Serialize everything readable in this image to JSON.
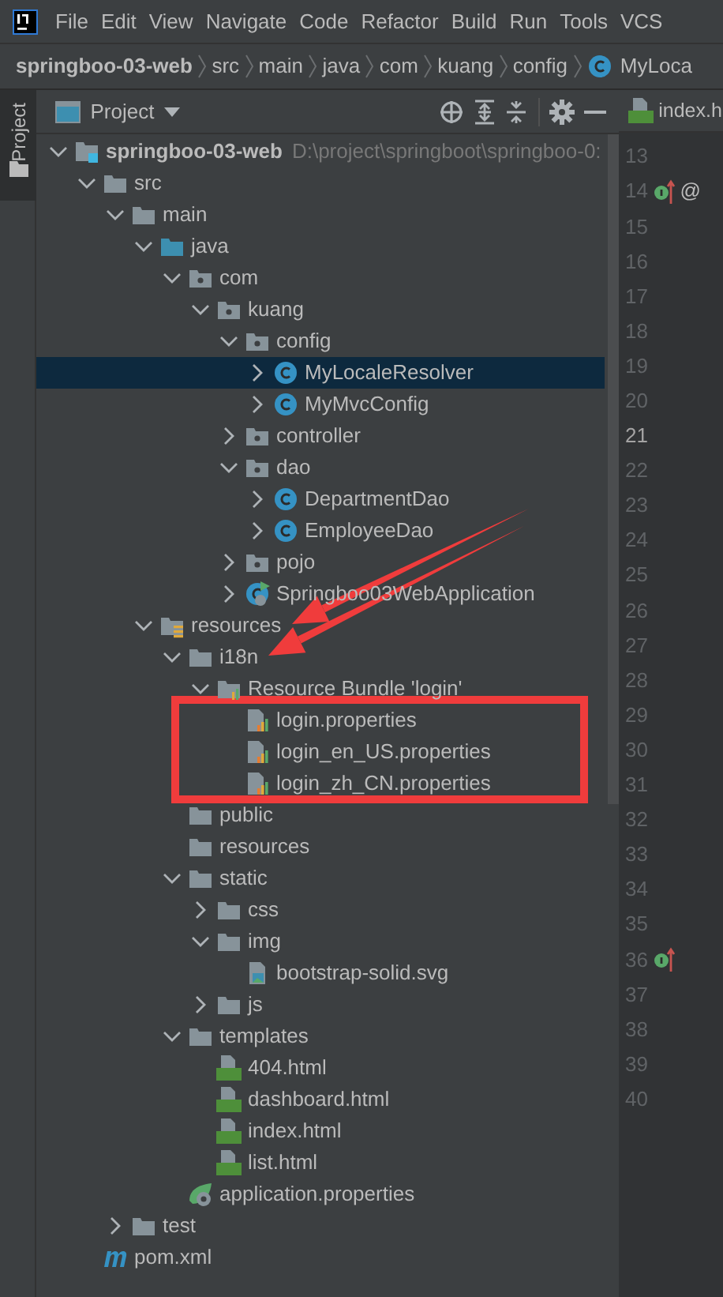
{
  "menu_bar": {
    "items": [
      "File",
      "Edit",
      "View",
      "Navigate",
      "Code",
      "Refactor",
      "Build",
      "Run",
      "Tools",
      "VCS"
    ]
  },
  "breadcrumbs": [
    {
      "label": "springboo-03-web",
      "kind": "module"
    },
    {
      "label": "src",
      "kind": "folder"
    },
    {
      "label": "main",
      "kind": "folder"
    },
    {
      "label": "java",
      "kind": "folder"
    },
    {
      "label": "com",
      "kind": "folder"
    },
    {
      "label": "kuang",
      "kind": "folder"
    },
    {
      "label": "config",
      "kind": "folder"
    },
    {
      "label": "MyLoca",
      "kind": "class"
    }
  ],
  "side_tab": {
    "label": "Project",
    "selected": true
  },
  "project_panel": {
    "title": "Project",
    "tree": [
      {
        "label": "springboo-03-web",
        "path": "D:\\project\\springboot\\springboo-0:",
        "kind": "module",
        "expanded": true,
        "selected": false,
        "children": [
          {
            "label": "src",
            "kind": "folder",
            "expanded": true,
            "selected": false,
            "children": [
              {
                "label": "main",
                "kind": "folder",
                "expanded": true,
                "selected": false,
                "children": [
                  {
                    "label": "java",
                    "kind": "source",
                    "expanded": true,
                    "selected": false,
                    "children": [
                      {
                        "label": "com",
                        "kind": "package",
                        "expanded": true,
                        "selected": false,
                        "children": [
                          {
                            "label": "kuang",
                            "kind": "package",
                            "expanded": true,
                            "selected": false,
                            "children": [
                              {
                                "label": "config",
                                "kind": "package",
                                "expanded": true,
                                "selected": false,
                                "children": [
                                  {
                                    "label": "MyLocaleResolver",
                                    "kind": "class",
                                    "expanded": false,
                                    "selected": true
                                  },
                                  {
                                    "label": "MyMvcConfig",
                                    "kind": "class",
                                    "expanded": false,
                                    "selected": false
                                  }
                                ]
                              },
                              {
                                "label": "controller",
                                "kind": "package",
                                "expanded": false,
                                "selected": false
                              },
                              {
                                "label": "dao",
                                "kind": "package",
                                "expanded": true,
                                "selected": false,
                                "children": [
                                  {
                                    "label": "DepartmentDao",
                                    "kind": "class",
                                    "expanded": false,
                                    "selected": false
                                  },
                                  {
                                    "label": "EmployeeDao",
                                    "kind": "class",
                                    "expanded": false,
                                    "selected": false
                                  }
                                ]
                              },
                              {
                                "label": "pojo",
                                "kind": "package",
                                "expanded": false,
                                "selected": false
                              },
                              {
                                "label": "Springboo03WebApplication",
                                "kind": "spring-class",
                                "expanded": false,
                                "selected": false
                              }
                            ]
                          }
                        ]
                      }
                    ]
                  },
                  {
                    "label": "resources",
                    "kind": "resources",
                    "expanded": true,
                    "selected": false,
                    "children": [
                      {
                        "label": "i18n",
                        "kind": "folder",
                        "expanded": true,
                        "selected": false,
                        "children": [
                          {
                            "label": "Resource Bundle 'login'",
                            "kind": "bundle",
                            "expanded": true,
                            "selected": false,
                            "children": [
                              {
                                "label": "login.properties",
                                "kind": "properties",
                                "selected": false
                              },
                              {
                                "label": "login_en_US.properties",
                                "kind": "properties",
                                "selected": false
                              },
                              {
                                "label": "login_zh_CN.properties",
                                "kind": "properties",
                                "selected": false
                              }
                            ]
                          }
                        ]
                      },
                      {
                        "label": "public",
                        "kind": "folder",
                        "selected": false
                      },
                      {
                        "label": "resources",
                        "kind": "folder",
                        "selected": false
                      },
                      {
                        "label": "static",
                        "kind": "folder",
                        "expanded": true,
                        "selected": false,
                        "children": [
                          {
                            "label": "css",
                            "kind": "folder",
                            "expanded": false,
                            "selected": false
                          },
                          {
                            "label": "img",
                            "kind": "folder",
                            "expanded": true,
                            "selected": false,
                            "children": [
                              {
                                "label": "bootstrap-solid.svg",
                                "kind": "image",
                                "selected": false
                              }
                            ]
                          },
                          {
                            "label": "js",
                            "kind": "folder",
                            "expanded": false,
                            "selected": false
                          }
                        ]
                      },
                      {
                        "label": "templates",
                        "kind": "folder",
                        "expanded": true,
                        "selected": false,
                        "children": [
                          {
                            "label": "404.html",
                            "kind": "html",
                            "selected": false
                          },
                          {
                            "label": "dashboard.html",
                            "kind": "html",
                            "selected": false
                          },
                          {
                            "label": "index.html",
                            "kind": "html",
                            "selected": false
                          },
                          {
                            "label": "list.html",
                            "kind": "html",
                            "selected": false
                          }
                        ]
                      },
                      {
                        "label": "application.properties",
                        "kind": "spring-properties",
                        "selected": false
                      }
                    ]
                  }
                ]
              },
              {
                "label": "test",
                "kind": "folder",
                "expanded": false,
                "selected": false
              }
            ]
          },
          {
            "label": "pom.xml",
            "kind": "maven",
            "selected": false
          }
        ]
      }
    ]
  },
  "editor": {
    "tab": "index.h",
    "lines": [
      {
        "number": "13",
        "current": false
      },
      {
        "number": "14",
        "current": false,
        "marker": true,
        "extra": "@"
      },
      {
        "number": "15",
        "current": false
      },
      {
        "number": "16",
        "current": false
      },
      {
        "number": "17",
        "current": false
      },
      {
        "number": "18",
        "current": false
      },
      {
        "number": "19",
        "current": false
      },
      {
        "number": "20",
        "current": false
      },
      {
        "number": "21",
        "current": true
      },
      {
        "number": "22",
        "current": false
      },
      {
        "number": "23",
        "current": false
      },
      {
        "number": "24",
        "current": false
      },
      {
        "number": "25",
        "current": false
      },
      {
        "number": "26",
        "current": false
      },
      {
        "number": "27",
        "current": false
      },
      {
        "number": "28",
        "current": false
      },
      {
        "number": "29",
        "current": false
      },
      {
        "number": "30",
        "current": false
      },
      {
        "number": "31",
        "current": false
      },
      {
        "number": "32",
        "current": false
      },
      {
        "number": "33",
        "current": false
      },
      {
        "number": "34",
        "current": false
      },
      {
        "number": "35",
        "current": false
      },
      {
        "number": "36",
        "current": false,
        "marker": true
      },
      {
        "number": "37",
        "current": false
      },
      {
        "number": "38",
        "current": false
      },
      {
        "number": "39",
        "current": false
      },
      {
        "number": "40",
        "current": false
      }
    ]
  },
  "annotations": [
    {
      "kind": "arrow"
    },
    {
      "kind": "arrow"
    },
    {
      "kind": "rectangle"
    }
  ]
}
